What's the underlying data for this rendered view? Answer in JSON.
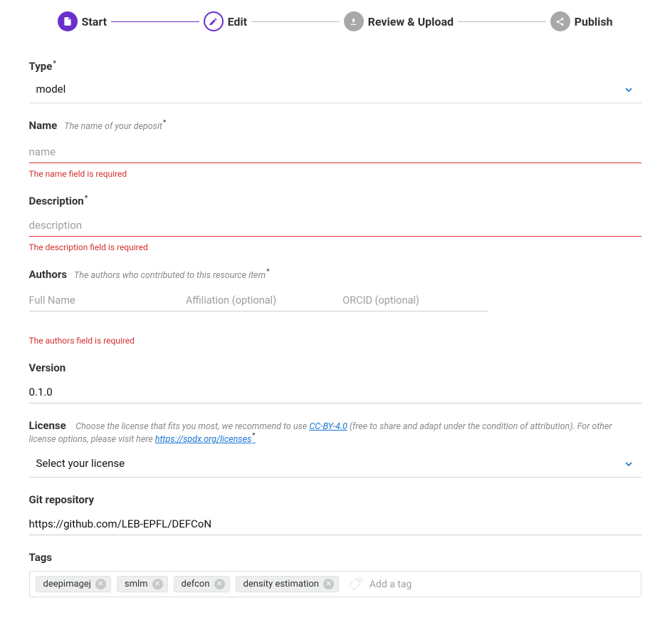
{
  "stepper": {
    "steps": [
      {
        "label": "Start"
      },
      {
        "label": "Edit"
      },
      {
        "label": "Review & Upload"
      },
      {
        "label": "Publish"
      }
    ]
  },
  "type": {
    "label": "Type",
    "value": "model"
  },
  "name": {
    "label": "Name",
    "help": "The name of your deposit",
    "placeholder": "name",
    "value": "",
    "error": "The name field is required"
  },
  "description": {
    "label": "Description",
    "placeholder": "description",
    "value": "",
    "error": "The description field is required"
  },
  "authors": {
    "label": "Authors",
    "help": "The authors who contributed to this resource item",
    "fullname_ph": "Full Name",
    "affiliation_ph": "Affiliation (optional)",
    "orcid_ph": "ORCID (optional)",
    "error": "The authors field is required"
  },
  "version": {
    "label": "Version",
    "value": "0.1.0"
  },
  "license": {
    "label": "License",
    "help_pre": "Choose the license that fits you most, we recommend to use ",
    "help_link1": "CC-BY-4.0",
    "help_mid": " (free to share and adapt under the condition of attribution). For other license options, please visit here ",
    "help_link2": "https://spdx.org/licenses",
    "placeholder": "Select your license"
  },
  "git": {
    "label": "Git repository",
    "value": "https://github.com/LEB-EPFL/DEFCoN"
  },
  "tags": {
    "label": "Tags",
    "items": [
      "deepimagej",
      "smlm",
      "defcon",
      "density estimation"
    ],
    "placeholder": "Add a tag"
  }
}
